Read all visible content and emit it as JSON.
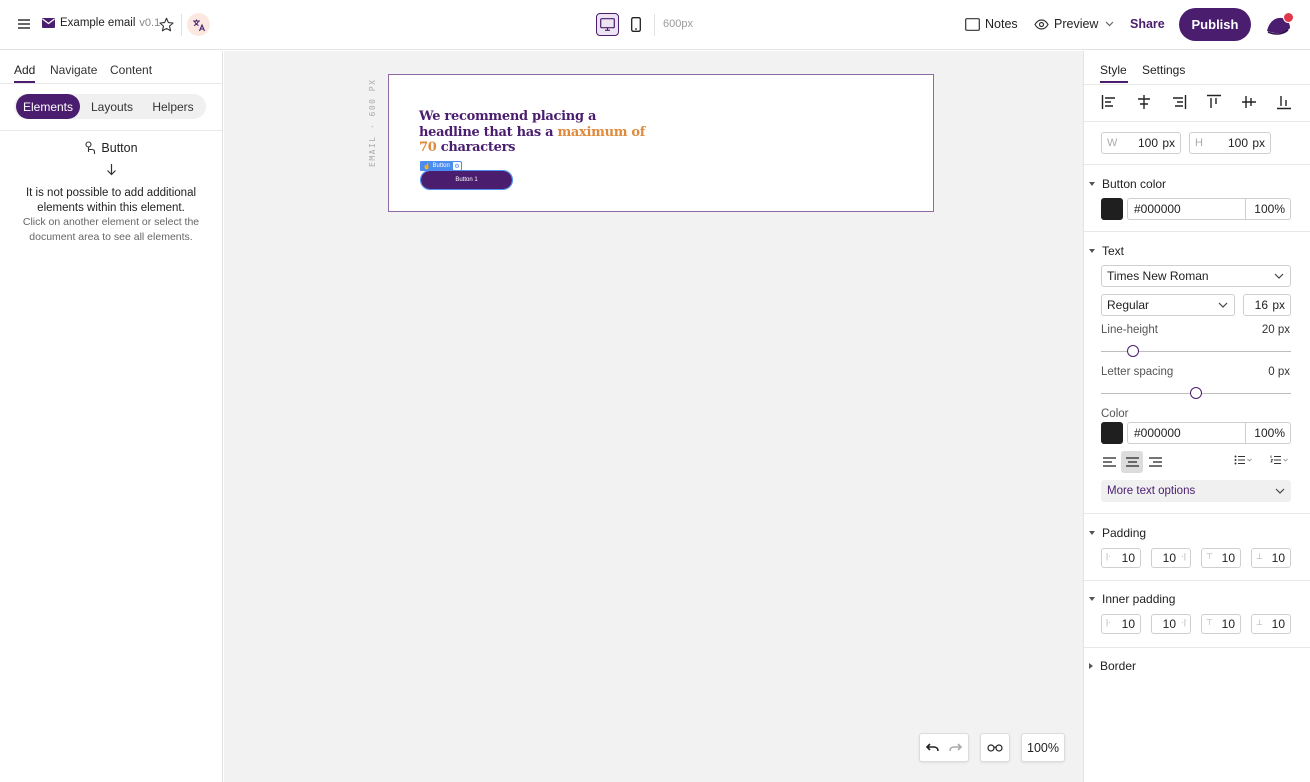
{
  "header": {
    "doc_title": "Example email",
    "version": "v0.1",
    "width_readout": "600px",
    "notes_label": "Notes",
    "preview_label": "Preview",
    "share_label": "Share",
    "publish_label": "Publish"
  },
  "left_panel": {
    "tabs": [
      {
        "label": "Add",
        "active": true
      },
      {
        "label": "Navigate",
        "active": false
      },
      {
        "label": "Content",
        "active": false
      }
    ],
    "segments": [
      {
        "label": "Elements",
        "active": true
      },
      {
        "label": "Layouts",
        "active": false
      },
      {
        "label": "Helpers",
        "active": false
      }
    ],
    "element_title": "Button",
    "message_main": "It is not possible to add additional elements within this element.",
    "message_hint": "Click on another element or select the document area to see all elements."
  },
  "canvas": {
    "side_label": "EMAIL · 600 PX",
    "headline_part1": "We recommend placing a headline that has a ",
    "headline_highlight": "maximum of 70",
    "headline_part2": " characters",
    "selection_tag": "Button",
    "button_text": "Button 1",
    "zoom": "100%"
  },
  "right_panel": {
    "tabs": [
      {
        "label": "Style",
        "active": true
      },
      {
        "label": "Settings",
        "active": false
      }
    ],
    "width_label": "W",
    "width_value": "100",
    "height_label": "H",
    "height_value": "100",
    "unit_px": "px",
    "button_color": {
      "title": "Button color",
      "hex": "#000000",
      "opacity": "100%"
    },
    "text": {
      "title": "Text",
      "font_family": "Times New Roman",
      "font_weight": "Regular",
      "font_size": "16",
      "line_height_label": "Line-height",
      "line_height_value": "20 px",
      "line_height_level": 0.17,
      "letter_spacing_label": "Letter spacing",
      "letter_spacing_value": "0 px",
      "letter_spacing_level": 0.5,
      "color_label": "Color",
      "color_hex": "#000000",
      "color_opacity": "100%",
      "more_options": "More text options"
    },
    "padding": {
      "title": "Padding",
      "left": "10",
      "right": "10",
      "top": "10",
      "bottom": "10"
    },
    "inner_padding": {
      "title": "Inner padding",
      "left": "10",
      "right": "10",
      "top": "10",
      "bottom": "10"
    },
    "border_title": "Border"
  },
  "colors": {
    "brand": "#4a1d6e",
    "highlight": "#e08a3c",
    "selection": "#4a8cf0",
    "swatch": "#1f1f1f"
  }
}
